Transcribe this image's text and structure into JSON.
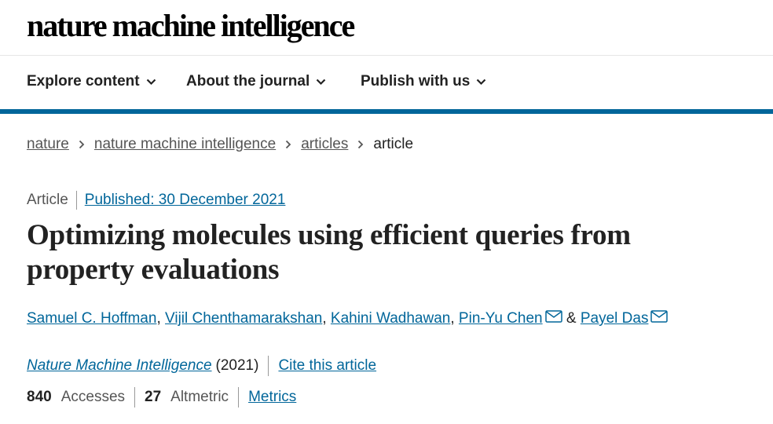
{
  "header": {
    "logo_text": "nature machine intelligence"
  },
  "nav": {
    "items": [
      {
        "label": "Explore content"
      },
      {
        "label": "About the journal"
      },
      {
        "label": "Publish with us"
      }
    ]
  },
  "accent_color": "#01669a",
  "breadcrumb": {
    "items": [
      "nature",
      "nature machine intelligence",
      "articles"
    ],
    "current": "article"
  },
  "article": {
    "type": "Article",
    "published": "Published: 30 December 2021",
    "title": "Optimizing molecules using efficient queries from property evaluations",
    "authors": [
      "Samuel C. Hoffman",
      "Vijil Chenthamarakshan",
      "Kahini Wadhawan",
      "Pin-Yu Chen",
      "Payel Das"
    ],
    "comma": ",",
    "ampersand": "&",
    "journal": "Nature Machine Intelligence",
    "year": "(2021)",
    "cite_label": "Cite this article",
    "accesses_count": "840",
    "accesses_label": "Accesses",
    "altmetric_count": "27",
    "altmetric_label": "Altmetric",
    "metrics_label": "Metrics"
  }
}
